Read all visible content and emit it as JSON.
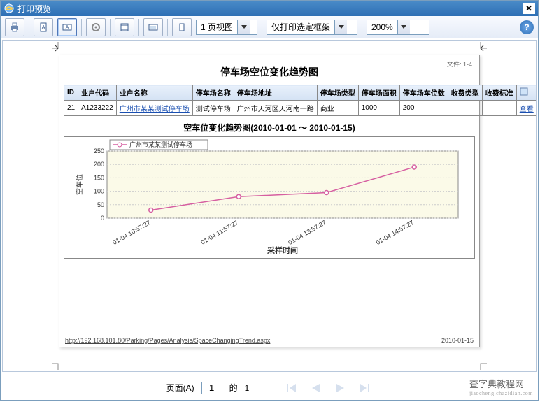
{
  "titlebar": {
    "title": "打印预览"
  },
  "toolbar": {
    "view_select": "1 页视图",
    "frame_select": "仅打印选定框架",
    "zoom_select": "200%"
  },
  "page": {
    "header_title": "停车场空位变化趋势图",
    "corner_notice": "文件: 1-4",
    "footer_url": "http://192.168.101.80/Parking/Pages/Analysis/SpaceChangingTrend.aspx",
    "footer_date": "2010-01-15"
  },
  "table": {
    "headers": [
      "ID",
      "业户代码",
      "业户名称",
      "停车场名称",
      "停车场地址",
      "停车场类型",
      "停车场面积",
      "停车场车位数",
      "收费类型",
      "收费标准",
      ""
    ],
    "row": {
      "id": "21",
      "code": "A1233222",
      "owner": "广州市某某测试停车场",
      "name": "测试停车场",
      "address": "广州市天河区天河南一路",
      "type": "商业",
      "area": "1000",
      "spots": "200",
      "fee_type": "",
      "fee_std": "",
      "view": "查看"
    }
  },
  "chart_data": {
    "type": "line",
    "title": "空车位变化趋势图(2010-01-01 ～ 2010-01-15)",
    "legend": [
      "广州市某某测试停车场"
    ],
    "ylabel": "空车位",
    "xlabel": "采样时间",
    "ylim": [
      0,
      250
    ],
    "yticks": [
      0,
      50,
      100,
      150,
      200,
      250
    ],
    "categories": [
      "01-04 10:57:27",
      "01-04 11:57:27",
      "01-04 13:57:27",
      "01-04 14:57:27"
    ],
    "series": [
      {
        "name": "广州市某某测试停车场",
        "values": [
          30,
          80,
          95,
          190
        ],
        "color": "#d65fa1"
      }
    ]
  },
  "pager": {
    "label_page": "页面(A)",
    "current": "1",
    "label_of": "的",
    "total": "1"
  },
  "watermark": {
    "main": "查字典教程网",
    "sub": "jiaocheng.chazidian.com"
  }
}
